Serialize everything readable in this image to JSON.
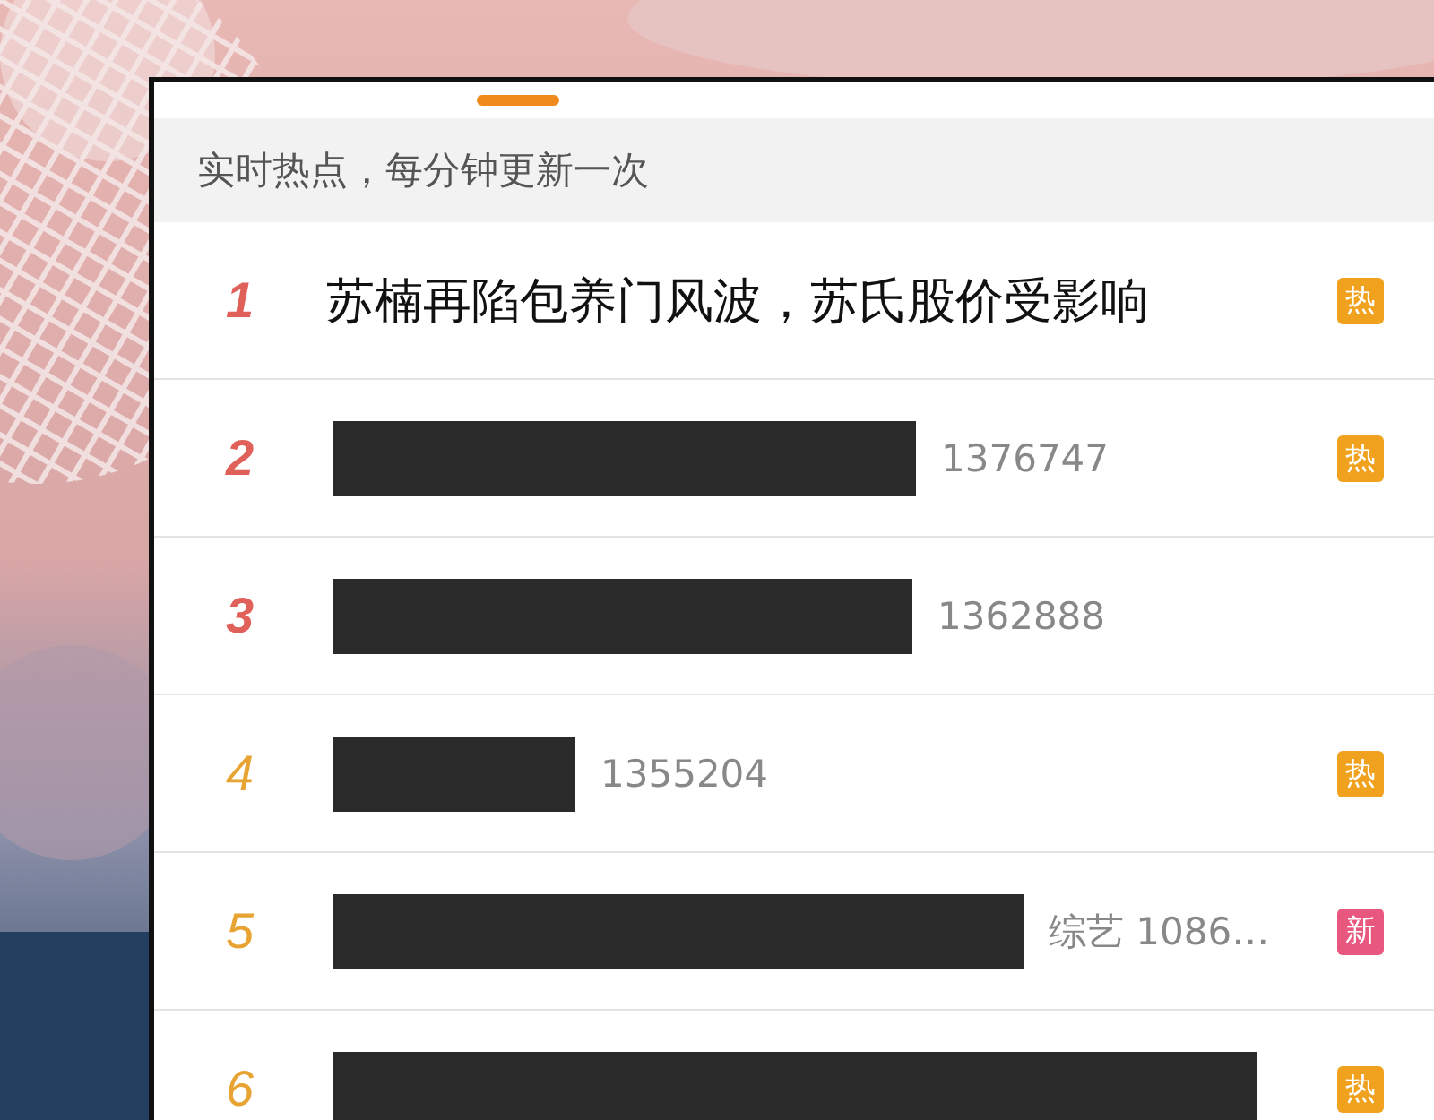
{
  "header": {
    "text": "实时热点，每分钟更新一次"
  },
  "tab_indicator": {
    "selected": true
  },
  "rows": [
    {
      "rank": "1",
      "kind": "top",
      "title": "苏楠再陷包养门风波，苏氏股价受影响",
      "badge": {
        "text": "热",
        "color": "#f0a21e"
      }
    },
    {
      "rank": "2",
      "kind": "top",
      "redacted": true,
      "count": "1376747",
      "badge": {
        "text": "热",
        "color": "#f0a21e"
      }
    },
    {
      "rank": "3",
      "kind": "top",
      "redacted": true,
      "count": "1362888"
    },
    {
      "rank": "4",
      "kind": "normal",
      "redacted": true,
      "count": "1355204",
      "badge": {
        "text": "热",
        "color": "#f0a21e"
      }
    },
    {
      "rank": "5",
      "kind": "normal",
      "redacted": true,
      "count": "综艺 1086…",
      "badge": {
        "text": "新",
        "color": "#e8587e"
      }
    },
    {
      "rank": "6",
      "kind": "normal",
      "redacted": true,
      "badge": {
        "text": "热",
        "color": "#f0a21e"
      }
    }
  ]
}
